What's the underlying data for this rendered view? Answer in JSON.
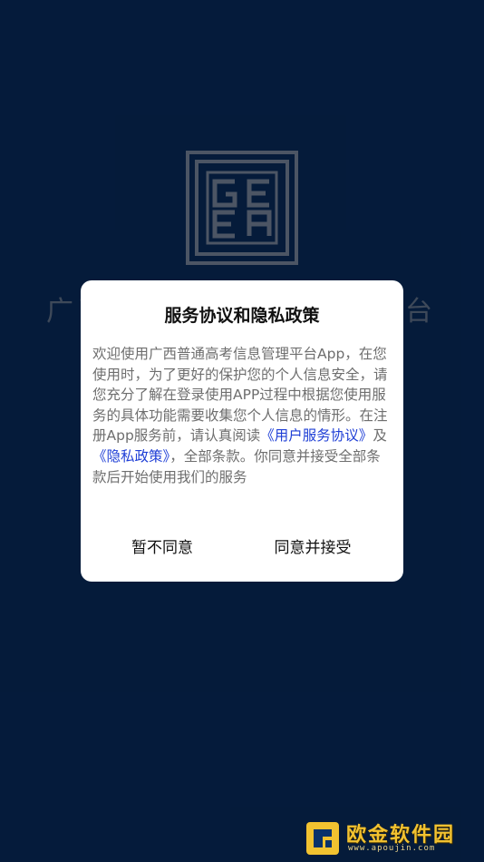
{
  "app": {
    "title": "广西普通高考信息管理平台",
    "logo_letters": "GEEA"
  },
  "dialog": {
    "title": "服务协议和隐私政策",
    "body_text_1": "欢迎使用广西普通高考信息管理平台App，在您使用时，为了更好的保护您的个人信息安全，请您充分了解在登录使用APP过程中根据您使用服务的具体功能需要收集您个人信息的情形。在注册App服务前，请认真阅读",
    "link_user_agreement": "《用户服务协议》",
    "body_text_2": "及",
    "link_privacy_policy": "《隐私政策》",
    "body_text_3": "，全部条款。你同意并接受全部条款后开始使用我们的服务",
    "decline_label": "暂不同意",
    "accept_label": "同意并接受"
  },
  "watermark": {
    "brand": "欧金软件园",
    "url": "www.apoujin.com"
  },
  "colors": {
    "background": "#0a326b",
    "link": "#1f3fd6",
    "watermark": "#f2c230"
  }
}
